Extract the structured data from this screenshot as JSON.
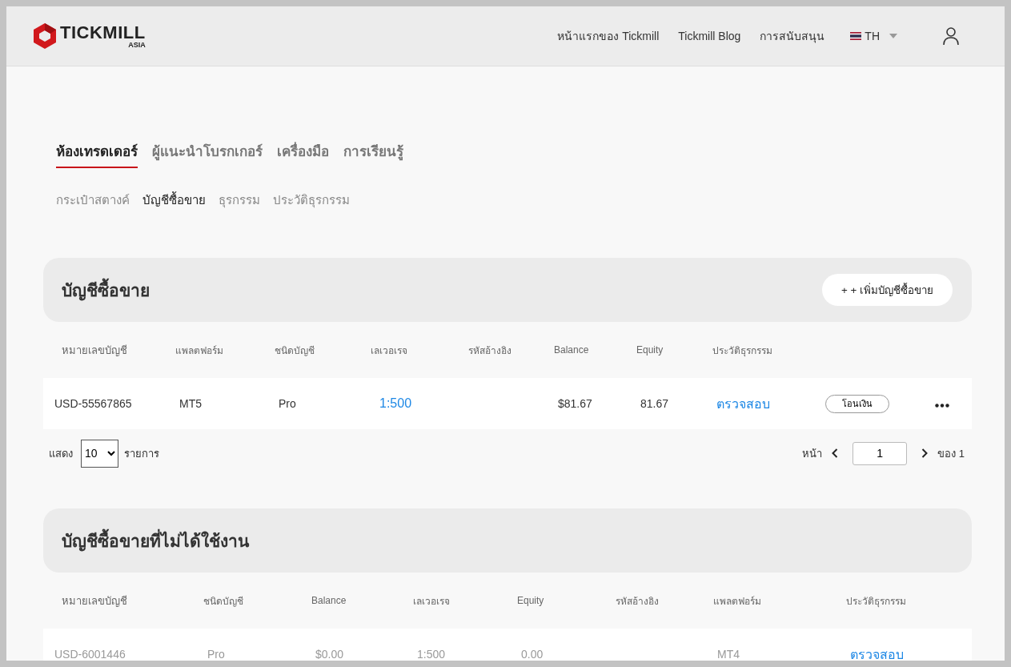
{
  "header": {
    "logo_text": "TICKMILL",
    "logo_sub": "ASIA",
    "nav": [
      {
        "label": "หน้าแรกของ Tickmill"
      },
      {
        "label": "Tickmill Blog"
      },
      {
        "label": "การสนับสนุน"
      }
    ],
    "language": "TH"
  },
  "main_tabs": [
    {
      "label": "ห้องเทรดเดอร์",
      "selected": true
    },
    {
      "label": "ผู้แนะนำโบรกเกอร์",
      "selected": false
    },
    {
      "label": "เครื่องมือ",
      "selected": false
    },
    {
      "label": "การเรียนรู้",
      "selected": false
    }
  ],
  "sub_tabs": [
    {
      "label": "กระเป๋าสตางค์",
      "selected": false
    },
    {
      "label": "บัญชีซื้อขาย",
      "selected": true
    },
    {
      "label": "ธุรกรรม",
      "selected": false
    },
    {
      "label": "ประวัติธุรกรรม",
      "selected": false
    }
  ],
  "sections": [
    {
      "title": "บัญชีซื้อขาย",
      "button": "+ + เพิ่มบัญชีซื้อขาย",
      "columns": [
        "หมายเลขบัญชี",
        "แพลตฟอร์ม",
        "ชนิดบัญชี",
        "เลเวอเรจ",
        "รหัสอ้างอิง",
        "Balance",
        "Equity",
        "ประวัติธุรกรรม"
      ],
      "rows": [
        {
          "disabled": false,
          "cells": [
            {
              "kind": "text",
              "text": "USD-55567865"
            },
            {
              "kind": "text",
              "text": "MT5"
            },
            {
              "kind": "text",
              "text": "Pro"
            },
            {
              "kind": "link",
              "text": "1:500"
            },
            {
              "kind": "text",
              "text": ""
            },
            {
              "kind": "text",
              "text": "$81.67"
            },
            {
              "kind": "text",
              "text": "81.67"
            },
            {
              "kind": "link",
              "text": "ตรวจสอบ"
            },
            {
              "kind": "button",
              "text": "โอนเงิน"
            },
            {
              "kind": "menu",
              "text": ""
            }
          ]
        }
      ],
      "pager": {
        "show_label": "แสดง",
        "page_size": "10",
        "items_label": "รายการ",
        "page_label": "หน้า",
        "page": "1",
        "of_label": "ของ 1"
      }
    },
    {
      "title": "บัญชีซื้อขายที่ไม่ได้ใช้งาน",
      "columns": [
        "หมายเลขบัญชี",
        "ชนิดบัญชี",
        "Balance",
        "เลเวอเรจ",
        "Equity",
        "รหัสอ้างอิง",
        "แพลตฟอร์ม",
        "ประวัติธุรกรรม"
      ],
      "rows": [
        {
          "disabled": true,
          "cells": [
            {
              "kind": "text",
              "text": "USD-6001446"
            },
            {
              "kind": "text",
              "text": "Pro"
            },
            {
              "kind": "text",
              "text": "$0.00"
            },
            {
              "kind": "text",
              "text": "1:500"
            },
            {
              "kind": "text",
              "text": "0.00"
            },
            {
              "kind": "text",
              "text": ""
            },
            {
              "kind": "text",
              "text": "MT4"
            },
            {
              "kind": "link",
              "text": "ตรวจสอบ"
            }
          ]
        }
      ]
    }
  ]
}
